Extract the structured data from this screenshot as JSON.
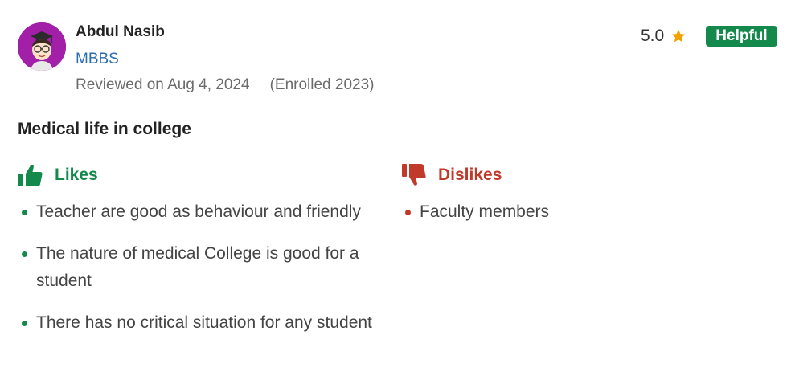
{
  "reviewer": {
    "name": "Abdul Nasib",
    "course": "MBBS",
    "reviewed_on": "Reviewed on Aug 4, 2024",
    "enrolled": "(Enrolled 2023)"
  },
  "rating": {
    "value": "5.0",
    "icon": "star-icon",
    "helpful_label": "Helpful"
  },
  "review": {
    "title": "Medical life in college"
  },
  "likes": {
    "label": "Likes",
    "icon": "thumbs-up-icon",
    "items": [
      "Teacher are good as behaviour and friendly",
      "The nature of medical College is good for a student",
      "There has no critical situation for any student"
    ]
  },
  "dislikes": {
    "label": "Dislikes",
    "icon": "thumbs-down-icon",
    "items": [
      "Faculty members"
    ]
  },
  "colors": {
    "likes": "#138a4c",
    "dislikes": "#c0392b",
    "link": "#2b6cb0",
    "star": "#f4a100",
    "avatar_bg": "#a21fa8",
    "helpful_bg": "#138a4c"
  }
}
